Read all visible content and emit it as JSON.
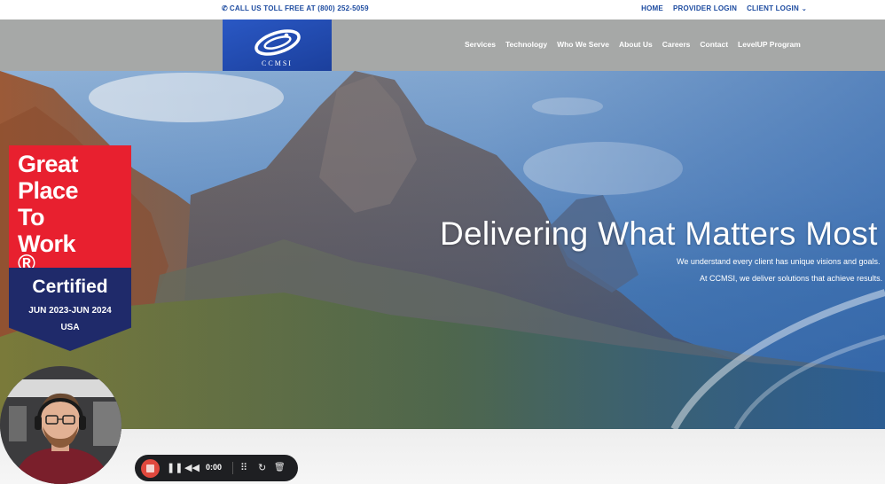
{
  "topbar": {
    "phone_icon": "phone-icon",
    "phone_text": "CALL US TOLL FREE AT (800) 252-5059",
    "links": [
      "HOME",
      "PROVIDER LOGIN",
      "CLIENT LOGIN"
    ],
    "client_login_chevron": "⌄"
  },
  "logo": {
    "text": "CCMSI",
    "accent": "#1d4ba0"
  },
  "nav": {
    "items": [
      "Services",
      "Technology",
      "Who We Serve",
      "About Us",
      "Careers",
      "Contact",
      "LevelUP Program"
    ]
  },
  "hero": {
    "title": "Delivering What Matters Most",
    "sub1": "We understand every client has unique visions and goals.",
    "sub2": "At CCMSI, we deliver solutions that achieve results."
  },
  "badge": {
    "lines": [
      "Great",
      "Place",
      "To",
      "Work"
    ],
    "registered": "®",
    "certified": "Certified",
    "dates": "JUN 2023-JUN 2024",
    "country": "USA",
    "colors": {
      "red": "#e8202f",
      "navy": "#1f2a6a"
    }
  },
  "recorder": {
    "time": "0:00",
    "icons": [
      "stop-icon",
      "pause-icon",
      "rewind-icon",
      "grid-icon",
      "restart-icon",
      "trash-icon"
    ],
    "glyphs": {
      "pause": "❚❚",
      "rewind": "◀◀",
      "grid": "⠿",
      "restart": "↻",
      "trash": "🗑"
    }
  }
}
